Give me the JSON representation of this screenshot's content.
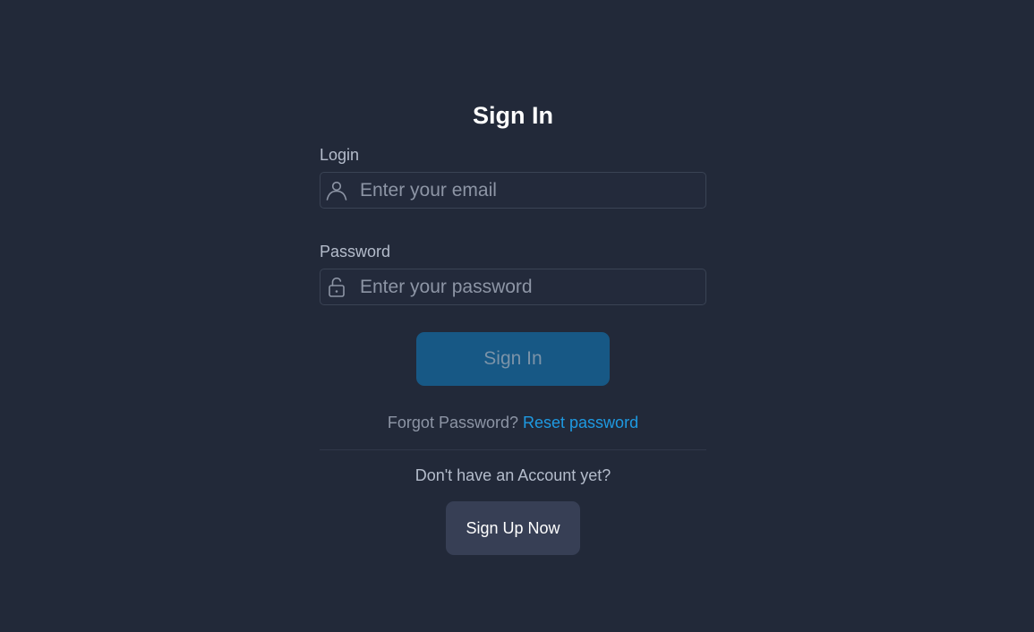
{
  "page": {
    "title": "Sign In"
  },
  "form": {
    "login": {
      "label": "Login",
      "placeholder": "Enter your email",
      "value": "",
      "icon": "user-icon"
    },
    "password": {
      "label": "Password",
      "placeholder": "Enter your password",
      "value": "",
      "icon": "lock-icon"
    },
    "submit_label": "Sign In"
  },
  "forgot": {
    "text": "Forgot Password?",
    "link_label": "Reset password"
  },
  "signup": {
    "prompt": "Don't have an Account yet?",
    "button_label": "Sign Up Now"
  },
  "colors": {
    "background": "#222939",
    "primary_button": "#175885",
    "secondary_button": "#373f55",
    "link": "#1e9ae2",
    "label_text": "#b4bccb",
    "placeholder_text": "#8d95a5"
  }
}
